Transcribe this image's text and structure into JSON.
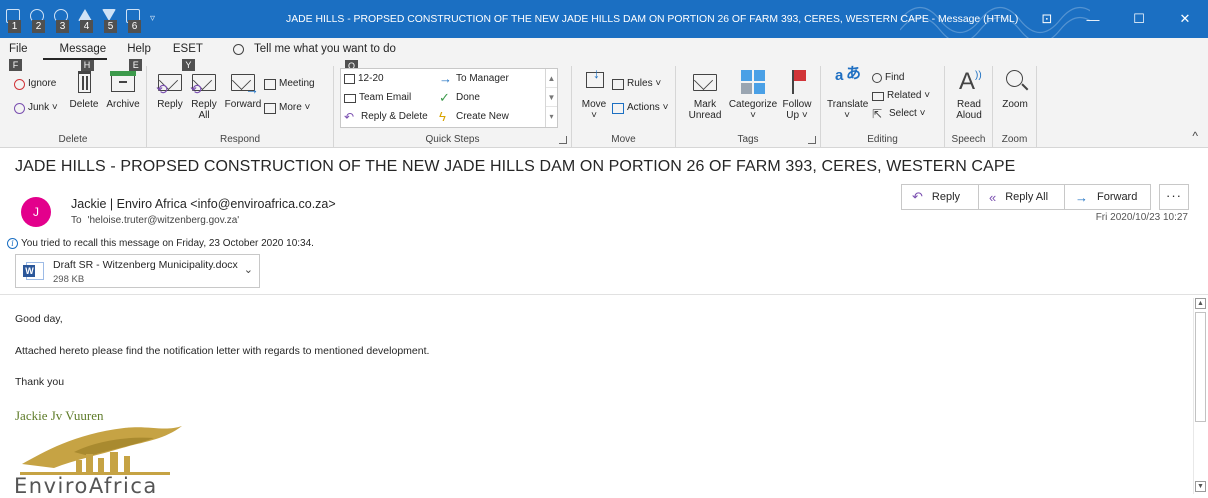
{
  "window": {
    "title": "JADE HILLS - PROPSED CONSTRUCTION OF THE NEW JADE HILLS DAM ON PORTION 26 OF FARM 393, CERES, WESTERN CAPE  -  Message (HTML)",
    "qat_keys": [
      "1",
      "2",
      "3",
      "4",
      "5",
      "6"
    ],
    "qat_dropdown": "▿",
    "controls": {
      "restore_ribbon": "⊡",
      "minimize": "—",
      "maximize": "☐",
      "close": "✕"
    }
  },
  "ribbon": {
    "tabs": [
      {
        "label": "File",
        "key": "F"
      },
      {
        "label": "Message",
        "key": "H"
      },
      {
        "label": "Help",
        "key": "E"
      },
      {
        "label": "ESET",
        "key": "Y"
      }
    ],
    "tell_me": "Tell me what you want to do",
    "tell_me_key": "Q",
    "groups": {
      "delete": {
        "label": "Delete",
        "ignore": "Ignore",
        "junk": "Junk ˅",
        "delete_btn": "Delete",
        "archive": "Archive"
      },
      "respond": {
        "label": "Respond",
        "reply": "Reply",
        "reply_all_1": "Reply",
        "reply_all_2": "All",
        "forward": "Forward",
        "meeting": "Meeting",
        "more": "More ˅"
      },
      "quick_steps": {
        "label": "Quick Steps",
        "items": [
          "12-20",
          "To Manager",
          "Team Email",
          "Done",
          "Reply & Delete",
          "Create New"
        ]
      },
      "move": {
        "label": "Move",
        "move_btn": "Move",
        "move_caret": "˅",
        "rules": "Rules ˅",
        "actions": "Actions ˅"
      },
      "tags": {
        "label": "Tags",
        "mark_unread_1": "Mark",
        "mark_unread_2": "Unread",
        "categorize": "Categorize",
        "categorize_caret": "˅",
        "follow_up_1": "Follow",
        "follow_up_2": "Up ˅"
      },
      "editing": {
        "label": "Editing",
        "translate": "Translate",
        "translate_caret": "˅",
        "find": "Find",
        "related": "Related ˅",
        "select": "Select ˅"
      },
      "speech": {
        "label": "Speech",
        "read_1": "Read",
        "read_2": "Aloud"
      },
      "zoom": {
        "label": "Zoom",
        "zoom_btn": "Zoom"
      }
    },
    "collapse": "^"
  },
  "message": {
    "subject": "JADE HILLS - PROPSED CONSTRUCTION OF THE NEW JADE HILLS DAM ON PORTION 26 OF FARM 393, CERES, WESTERN CAPE",
    "avatar_initial": "J",
    "sender": "Jackie | Enviro Africa <info@enviroafrica.co.za>",
    "to_label": "To",
    "to": "'heloise.truter@witzenberg.gov.za'",
    "recall_notice": "You tried to recall this message on Friday, 23 October 2020 10:34.",
    "attachment": {
      "name": "Draft SR - Witzenberg Municipality.docx",
      "size": "298 KB"
    },
    "actions": {
      "reply": "Reply",
      "reply_all": "Reply All",
      "forward": "Forward",
      "more": "···"
    },
    "date": "Fri 2020/10/23 10:27",
    "body": {
      "greeting": "Good day,",
      "paragraph": "Attached hereto please find the notification letter with regards to mentioned development.",
      "closing": "Thank you"
    },
    "signature_name": "Jackie Jv Vuuren",
    "logo_text": "EnviroAfrica"
  },
  "colors": {
    "title_bar": "#1b6fc2",
    "ribbon_bg": "#f3f3f3",
    "avatar": "#e3008c",
    "reply_icon": "#7a4fb0",
    "signature": "#5f7c2a",
    "logo_gold": "#c6a344"
  },
  "icons": {
    "ignore": "ignore-icon",
    "junk": "junk-icon",
    "delete": "trash-icon",
    "archive": "archive-icon",
    "reply": "reply-icon",
    "reply_all": "reply-all-icon",
    "forward": "forward-icon",
    "mark_unread": "envelope-icon",
    "categorize": "category-icon",
    "follow_up": "flag-icon",
    "translate": "translate-icon",
    "find": "search-icon",
    "read_aloud": "read-aloud-icon",
    "zoom": "zoom-icon"
  }
}
